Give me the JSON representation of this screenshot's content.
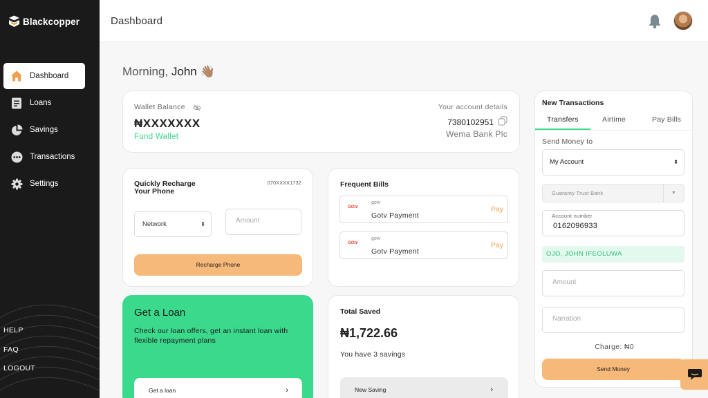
{
  "brand": {
    "name": "Blackcopper"
  },
  "sidebar": {
    "items": [
      {
        "label": "Dashboard",
        "icon": "home-icon",
        "active": true
      },
      {
        "label": "Loans",
        "icon": "document-icon"
      },
      {
        "label": "Savings",
        "icon": "pie-chart-icon"
      },
      {
        "label": "Transactions",
        "icon": "chat-dots-icon"
      },
      {
        "label": "Settings",
        "icon": "gear-icon"
      }
    ],
    "bottom": [
      "HELP",
      "FAQ",
      "LOGOUT"
    ]
  },
  "header": {
    "title": "Dashboard"
  },
  "greeting": {
    "prefix": "Morning,",
    "name": "John",
    "emoji": "👋🏽"
  },
  "wallet": {
    "label": "Wallet Balance",
    "balance": "₦XXXXXXX",
    "fund_label": "Fund Wallet",
    "account_label": "Your account details",
    "account_number": "7380102951",
    "bank": "Wema Bank Plc"
  },
  "recharge": {
    "title": "Quickly Recharge Your Phone",
    "phone": "070XXXX1732",
    "network_label": "Network",
    "amount_placeholder": "Amount",
    "button_label": "Recharge Phone"
  },
  "bills": {
    "title": "Frequent Bills",
    "items": [
      {
        "logo": "GOtv",
        "service": "gotv",
        "name": "Gotv Payment",
        "action": "Pay"
      },
      {
        "logo": "GOtv",
        "service": "gotv",
        "name": "Gotv Payment",
        "action": "Pay"
      }
    ]
  },
  "loan": {
    "title": "Get a Loan",
    "text": "Check our loan offers, get an instant loan with flexible repayment plans",
    "button_label": "Get a loan"
  },
  "savings": {
    "title": "Total Saved",
    "amount": "₦1,722.66",
    "count_text": "You have 3 savings",
    "button_label": "New Saving"
  },
  "transactions": {
    "title": "New Transactions",
    "tabs": [
      "Transfers",
      "Airtime",
      "Pay Bills"
    ],
    "send_label": "Send Money to",
    "recipient": "My Account",
    "bank": "Guaranty Trust Bank",
    "account_label": "Account number",
    "account_number": "0162096933",
    "account_name": "OJO, JOHN IFEOLUWA",
    "amount_placeholder": "Amount",
    "narration_placeholder": "Narration",
    "charge": "Charge: ₦0",
    "button_label": "Send Money"
  },
  "colors": {
    "accent_green": "#3ad98c",
    "accent_orange": "#f7b979",
    "sidebar": "#1a1a1a"
  }
}
